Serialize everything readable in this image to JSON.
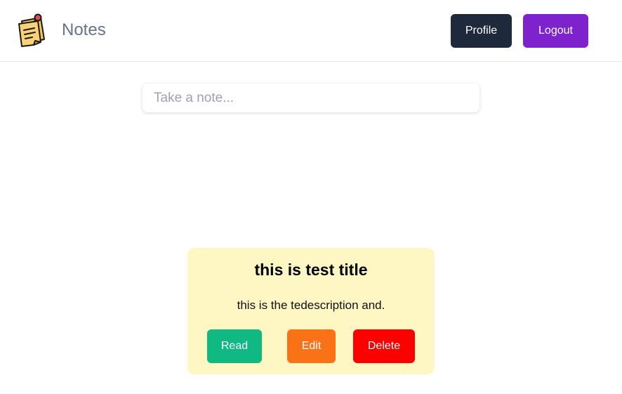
{
  "header": {
    "brand_name": "Notes",
    "logo_icon": "sticky-note-pin-icon",
    "profile_label": "Profile",
    "logout_label": "Logout"
  },
  "composer": {
    "placeholder": "Take a note...",
    "value": ""
  },
  "notes": [
    {
      "title": "this is test title",
      "description": "this is the tedescription and.",
      "read_label": "Read",
      "edit_label": "Edit",
      "delete_label": "Delete"
    }
  ],
  "colors": {
    "profile_button": "#1e293b",
    "logout_button": "#7e22ce",
    "note_background": "#fef7c3",
    "read_button": "#10b981",
    "edit_button": "#f97316",
    "delete_button": "#ff0000",
    "brand_text": "#64748b"
  }
}
